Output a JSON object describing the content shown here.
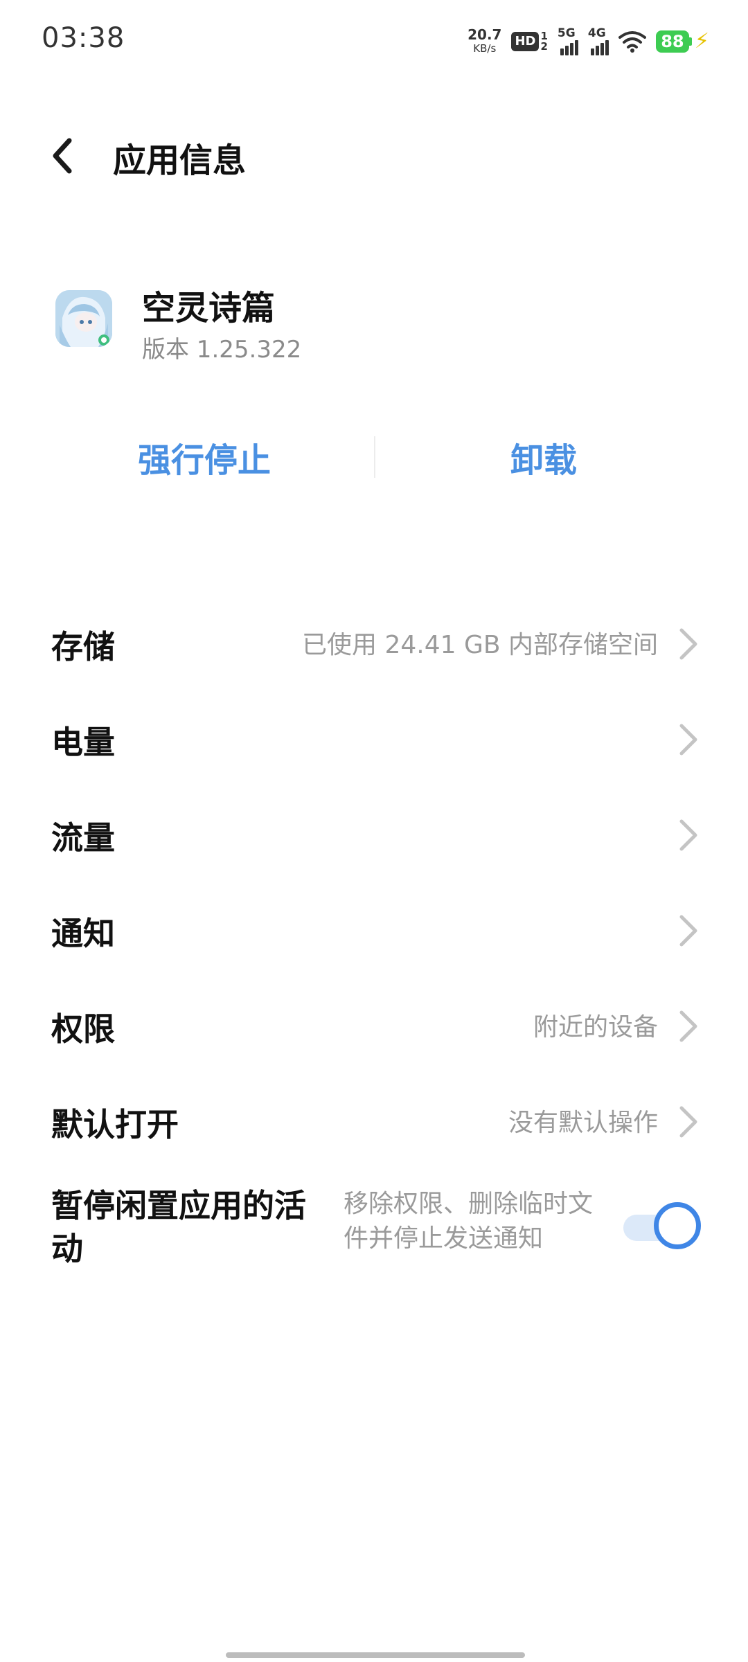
{
  "status_bar": {
    "time": "03:38",
    "net_speed_value": "20.7",
    "net_speed_unit": "KB/s",
    "hd_label": "HD",
    "hd_sub_top": "1",
    "hd_sub_bottom": "2",
    "signal1_gen": "5G",
    "signal2_gen": "4G",
    "battery_level": "88",
    "battery_color": "#3dcc52",
    "icons": [
      "hd-icon",
      "signal-5g-icon",
      "signal-4g-icon",
      "wifi-icon",
      "battery-icon",
      "charging-icon"
    ]
  },
  "header": {
    "back_icon": "chevron-left-icon",
    "title": "应用信息"
  },
  "app": {
    "name": "空灵诗篇",
    "version": "版本 1.25.322",
    "icon": "app-icon"
  },
  "actions": {
    "force_stop": "强行停止",
    "uninstall": "卸载",
    "accent_color": "#4a90e2"
  },
  "settings": {
    "items": [
      {
        "label": "存储",
        "value": "已使用 24.41 GB 内部存储空间"
      },
      {
        "label": "电量",
        "value": ""
      },
      {
        "label": "流量",
        "value": ""
      },
      {
        "label": "通知",
        "value": ""
      },
      {
        "label": "权限",
        "value": "附近的设备"
      },
      {
        "label": "默认打开",
        "value": "没有默认操作"
      }
    ],
    "pause_idle": {
      "label": "暂停闲置应用的活动",
      "description": "移除权限、删除临时文件并停止发送通知",
      "enabled": true
    }
  }
}
